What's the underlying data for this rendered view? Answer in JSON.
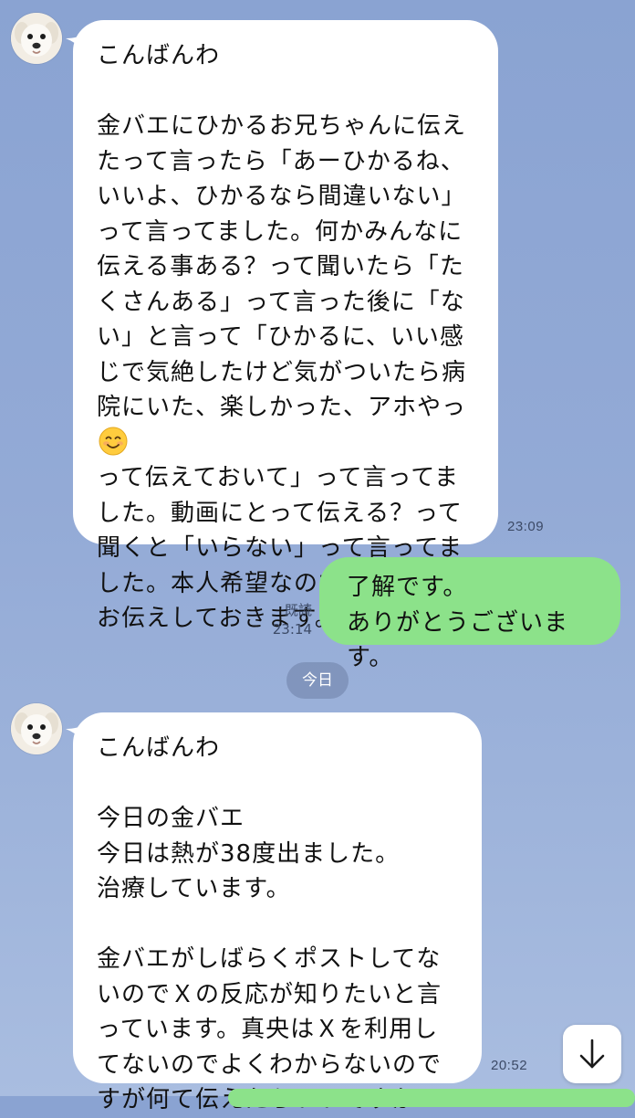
{
  "messages": [
    {
      "direction": "incoming",
      "avatar": "puppy-avatar",
      "text": "こんばんわ\n\n金バエにひかるお兄ちゃんに伝えたって言ったら「あーひかるね、いいよ、ひかるなら間違いない」って言ってました。何かみんなに伝える事ある？って聞いたら「たくさんある」って言った後に「ない」と言って「ひかるに、いい感じで気絶したけど気がついたら病院にいた、楽しかった、アホやっ",
      "emoji": "smiling-face-emoji",
      "text_after_emoji": "\nって伝えておいて」って言ってました。動画にとって伝える？って聞くと「いらない」って言ってました。本人希望なので、それだけお伝えしておきます。",
      "time": "23:09"
    },
    {
      "direction": "outgoing",
      "text": "了解です。\nありがとうございます。",
      "read_label": "既読",
      "time": "23:14"
    },
    {
      "direction": "incoming",
      "avatar": "puppy-avatar",
      "text": "こんばんわ\n\n今日の金バエ\n今日は熱が38度出ました。\n治療しています。\n\n金バエがしばらくポストしてないのでＸの反応が知りたいと言っています。真央はＸを利用してないのでよくわからないのですが何て伝えたらいいですか",
      "time": "20:52"
    }
  ],
  "date_separator": "今日",
  "scroll_button_icon": "arrow-down-icon",
  "colors": {
    "background": "#8ea6d4",
    "incoming_bubble": "#ffffff",
    "outgoing_bubble": "#8ce28a",
    "meta_text": "#3c4a66"
  }
}
